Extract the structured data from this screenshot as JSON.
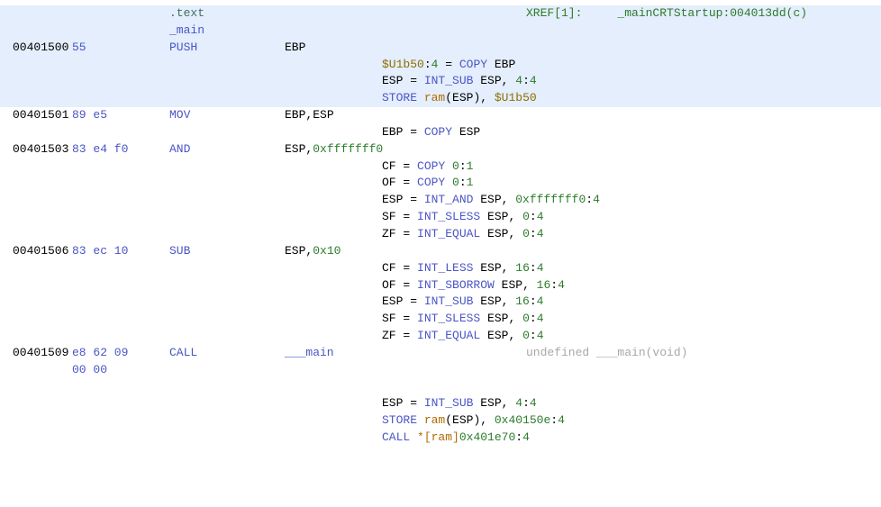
{
  "header": {
    "section": ".text",
    "xref_label": "XREF[1]:",
    "xref_target": "_mainCRTStartup:004013dd(c)",
    "func_label": "_main"
  },
  "rows": [
    {
      "addr": "00401500",
      "bytes": "55",
      "mnem": "PUSH",
      "operands": [
        {
          "t": "reg",
          "v": "EBP"
        }
      ]
    },
    {
      "addr": "00401501",
      "bytes": "89 e5",
      "mnem": "MOV",
      "operands": [
        {
          "t": "reg",
          "v": "EBP"
        },
        {
          "t": "comma",
          "v": ","
        },
        {
          "t": "reg",
          "v": "ESP"
        }
      ]
    },
    {
      "addr": "00401503",
      "bytes": "83 e4 f0",
      "mnem": "AND",
      "operands": [
        {
          "t": "reg",
          "v": "ESP"
        },
        {
          "t": "comma",
          "v": ","
        },
        {
          "t": "num",
          "v": "0xfffffff0"
        }
      ]
    },
    {
      "addr": "00401506",
      "bytes": "83 ec 10",
      "mnem": "SUB",
      "operands": [
        {
          "t": "reg",
          "v": "ESP"
        },
        {
          "t": "comma",
          "v": ","
        },
        {
          "t": "num",
          "v": "0x10"
        }
      ]
    },
    {
      "addr": "00401509",
      "bytes": "e8 62 09",
      "mnem": "CALL",
      "operands": [
        {
          "t": "kw",
          "v": "___main"
        }
      ],
      "eol": "undefined ___main(void)"
    }
  ],
  "bytes_cont": "00 00",
  "pcode": {
    "00401500": [
      [
        {
          "t": "var",
          "v": "$U1b50"
        },
        {
          "t": "reg",
          "v": ":"
        },
        {
          "t": "num",
          "v": "4"
        },
        {
          "t": "reg",
          "v": " = "
        },
        {
          "t": "op",
          "v": "COPY"
        },
        {
          "t": "reg",
          "v": " EBP"
        }
      ],
      [
        {
          "t": "reg",
          "v": "ESP = "
        },
        {
          "t": "op",
          "v": "INT_SUB"
        },
        {
          "t": "reg",
          "v": " ESP"
        },
        {
          "t": "comma",
          "v": ", "
        },
        {
          "t": "num",
          "v": "4"
        },
        {
          "t": "reg",
          "v": ":"
        },
        {
          "t": "num",
          "v": "4"
        }
      ],
      [
        {
          "t": "op",
          "v": "STORE"
        },
        {
          "t": "reg",
          "v": " "
        },
        {
          "t": "ram",
          "v": "ram"
        },
        {
          "t": "reg",
          "v": "(ESP)"
        },
        {
          "t": "comma",
          "v": ", "
        },
        {
          "t": "var",
          "v": "$U1b50"
        }
      ]
    ],
    "00401501": [
      [
        {
          "t": "reg",
          "v": "EBP = "
        },
        {
          "t": "op",
          "v": "COPY"
        },
        {
          "t": "reg",
          "v": " ESP"
        }
      ]
    ],
    "00401503": [
      [
        {
          "t": "reg",
          "v": "CF = "
        },
        {
          "t": "op",
          "v": "COPY"
        },
        {
          "t": "reg",
          "v": " "
        },
        {
          "t": "num",
          "v": "0"
        },
        {
          "t": "reg",
          "v": ":"
        },
        {
          "t": "num",
          "v": "1"
        }
      ],
      [
        {
          "t": "reg",
          "v": "OF = "
        },
        {
          "t": "op",
          "v": "COPY"
        },
        {
          "t": "reg",
          "v": " "
        },
        {
          "t": "num",
          "v": "0"
        },
        {
          "t": "reg",
          "v": ":"
        },
        {
          "t": "num",
          "v": "1"
        }
      ],
      [
        {
          "t": "reg",
          "v": "ESP = "
        },
        {
          "t": "op",
          "v": "INT_AND"
        },
        {
          "t": "reg",
          "v": " ESP"
        },
        {
          "t": "comma",
          "v": ", "
        },
        {
          "t": "num",
          "v": "0xfffffff0"
        },
        {
          "t": "reg",
          "v": ":"
        },
        {
          "t": "num",
          "v": "4"
        }
      ],
      [
        {
          "t": "reg",
          "v": "SF = "
        },
        {
          "t": "op",
          "v": "INT_SLESS"
        },
        {
          "t": "reg",
          "v": " ESP"
        },
        {
          "t": "comma",
          "v": ", "
        },
        {
          "t": "num",
          "v": "0"
        },
        {
          "t": "reg",
          "v": ":"
        },
        {
          "t": "num",
          "v": "4"
        }
      ],
      [
        {
          "t": "reg",
          "v": "ZF = "
        },
        {
          "t": "op",
          "v": "INT_EQUAL"
        },
        {
          "t": "reg",
          "v": " ESP"
        },
        {
          "t": "comma",
          "v": ", "
        },
        {
          "t": "num",
          "v": "0"
        },
        {
          "t": "reg",
          "v": ":"
        },
        {
          "t": "num",
          "v": "4"
        }
      ]
    ],
    "00401506": [
      [
        {
          "t": "reg",
          "v": "CF = "
        },
        {
          "t": "op",
          "v": "INT_LESS"
        },
        {
          "t": "reg",
          "v": " ESP"
        },
        {
          "t": "comma",
          "v": ", "
        },
        {
          "t": "num",
          "v": "16"
        },
        {
          "t": "reg",
          "v": ":"
        },
        {
          "t": "num",
          "v": "4"
        }
      ],
      [
        {
          "t": "reg",
          "v": "OF = "
        },
        {
          "t": "op",
          "v": "INT_SBORROW"
        },
        {
          "t": "reg",
          "v": " ESP"
        },
        {
          "t": "comma",
          "v": ", "
        },
        {
          "t": "num",
          "v": "16"
        },
        {
          "t": "reg",
          "v": ":"
        },
        {
          "t": "num",
          "v": "4"
        }
      ],
      [
        {
          "t": "reg",
          "v": "ESP = "
        },
        {
          "t": "op",
          "v": "INT_SUB"
        },
        {
          "t": "reg",
          "v": " ESP"
        },
        {
          "t": "comma",
          "v": ", "
        },
        {
          "t": "num",
          "v": "16"
        },
        {
          "t": "reg",
          "v": ":"
        },
        {
          "t": "num",
          "v": "4"
        }
      ],
      [
        {
          "t": "reg",
          "v": "SF = "
        },
        {
          "t": "op",
          "v": "INT_SLESS"
        },
        {
          "t": "reg",
          "v": " ESP"
        },
        {
          "t": "comma",
          "v": ", "
        },
        {
          "t": "num",
          "v": "0"
        },
        {
          "t": "reg",
          "v": ":"
        },
        {
          "t": "num",
          "v": "4"
        }
      ],
      [
        {
          "t": "reg",
          "v": "ZF = "
        },
        {
          "t": "op",
          "v": "INT_EQUAL"
        },
        {
          "t": "reg",
          "v": " ESP"
        },
        {
          "t": "comma",
          "v": ", "
        },
        {
          "t": "num",
          "v": "0"
        },
        {
          "t": "reg",
          "v": ":"
        },
        {
          "t": "num",
          "v": "4"
        }
      ]
    ],
    "00401509": [
      [
        {
          "t": "reg",
          "v": "ESP = "
        },
        {
          "t": "op",
          "v": "INT_SUB"
        },
        {
          "t": "reg",
          "v": " ESP"
        },
        {
          "t": "comma",
          "v": ", "
        },
        {
          "t": "num",
          "v": "4"
        },
        {
          "t": "reg",
          "v": ":"
        },
        {
          "t": "num",
          "v": "4"
        }
      ],
      [
        {
          "t": "op",
          "v": "STORE"
        },
        {
          "t": "reg",
          "v": " "
        },
        {
          "t": "ram",
          "v": "ram"
        },
        {
          "t": "reg",
          "v": "(ESP)"
        },
        {
          "t": "comma",
          "v": ", "
        },
        {
          "t": "num",
          "v": "0x40150e"
        },
        {
          "t": "reg",
          "v": ":"
        },
        {
          "t": "num",
          "v": "4"
        }
      ],
      [
        {
          "t": "op",
          "v": "CALL"
        },
        {
          "t": "reg",
          "v": " "
        },
        {
          "t": "ram",
          "v": "*[ram]"
        },
        {
          "t": "num",
          "v": "0x401e70"
        },
        {
          "t": "reg",
          "v": ":"
        },
        {
          "t": "num",
          "v": "4"
        }
      ]
    ]
  }
}
